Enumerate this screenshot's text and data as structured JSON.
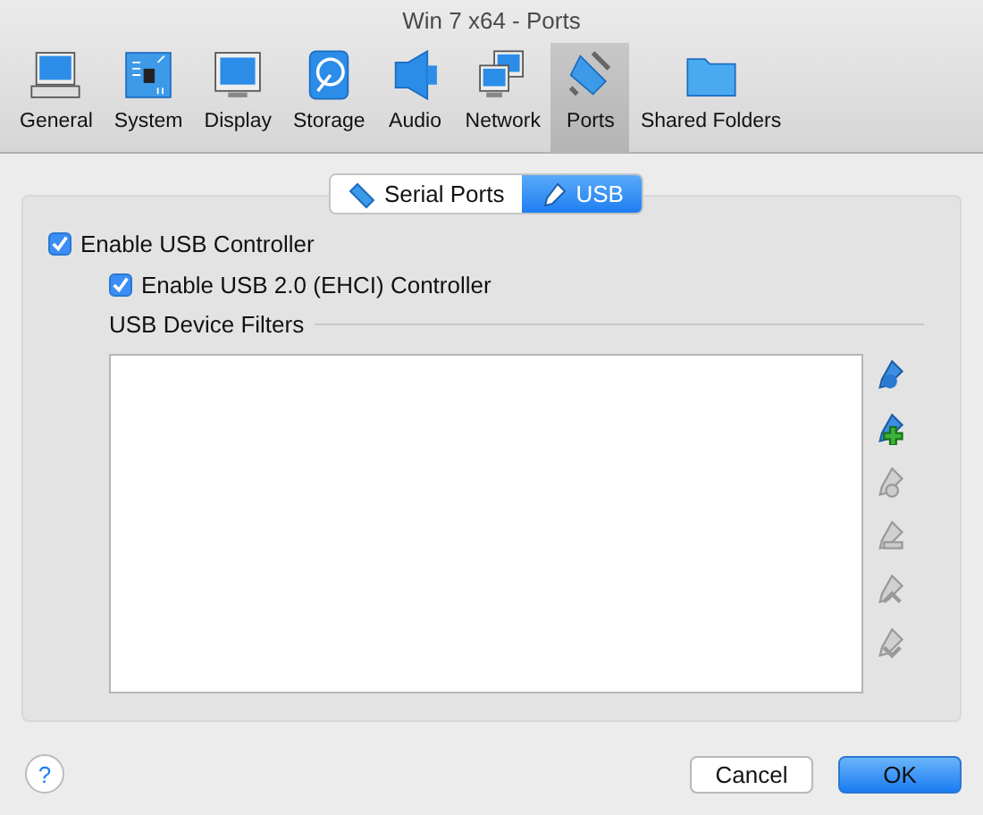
{
  "window": {
    "title": "Win 7 x64 - Ports"
  },
  "toolbar": [
    {
      "label": "General",
      "kind": "general",
      "selected": false
    },
    {
      "label": "System",
      "kind": "system",
      "selected": false
    },
    {
      "label": "Display",
      "kind": "display",
      "selected": false
    },
    {
      "label": "Storage",
      "kind": "storage",
      "selected": false
    },
    {
      "label": "Audio",
      "kind": "audio",
      "selected": false
    },
    {
      "label": "Network",
      "kind": "network",
      "selected": false
    },
    {
      "label": "Ports",
      "kind": "ports",
      "selected": true
    },
    {
      "label": "Shared Folders",
      "kind": "folder",
      "selected": false
    }
  ],
  "tabs": [
    {
      "label": "Serial Ports",
      "kind": "serial",
      "selected": false
    },
    {
      "label": "USB",
      "kind": "usb",
      "selected": true
    }
  ],
  "usb": {
    "enable_controller": {
      "label": "Enable USB Controller",
      "checked": true
    },
    "enable_ehci": {
      "label": "Enable USB 2.0 (EHCI) Controller",
      "checked": true
    },
    "filters_label": "USB Device Filters",
    "filter_tools": [
      {
        "kind": "add",
        "disabled": false
      },
      {
        "kind": "add-from-device",
        "disabled": false
      },
      {
        "kind": "edit",
        "disabled": true
      },
      {
        "kind": "remove",
        "disabled": true
      },
      {
        "kind": "up",
        "disabled": true
      },
      {
        "kind": "down",
        "disabled": true
      }
    ]
  },
  "help": "?",
  "buttons": [
    {
      "label": "Cancel",
      "kind": "default"
    },
    {
      "label": "OK",
      "kind": "primary"
    }
  ]
}
